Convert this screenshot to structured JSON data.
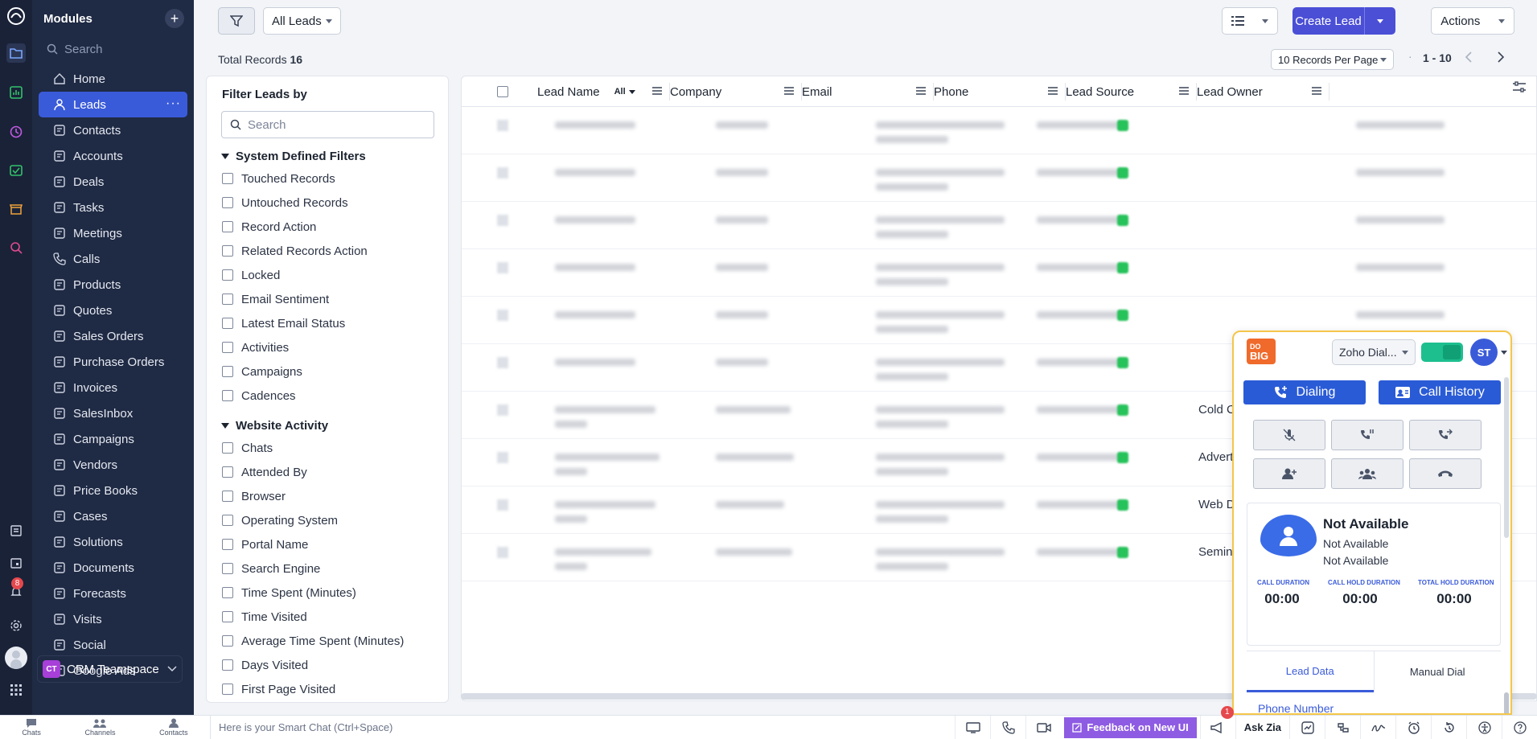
{
  "sidebar": {
    "title": "Modules",
    "search_placeholder": "Search",
    "items": [
      {
        "label": "Home",
        "icon": "home-icon"
      },
      {
        "label": "Leads",
        "icon": "leads-icon",
        "active": true
      },
      {
        "label": "Contacts",
        "icon": "contacts-icon"
      },
      {
        "label": "Accounts",
        "icon": "accounts-icon"
      },
      {
        "label": "Deals",
        "icon": "deals-icon"
      },
      {
        "label": "Tasks",
        "icon": "tasks-icon"
      },
      {
        "label": "Meetings",
        "icon": "meetings-icon"
      },
      {
        "label": "Calls",
        "icon": "calls-icon"
      },
      {
        "label": "Products",
        "icon": "products-icon"
      },
      {
        "label": "Quotes",
        "icon": "quotes-icon"
      },
      {
        "label": "Sales Orders",
        "icon": "sales-orders-icon"
      },
      {
        "label": "Purchase Orders",
        "icon": "purchase-orders-icon"
      },
      {
        "label": "Invoices",
        "icon": "invoices-icon"
      },
      {
        "label": "SalesInbox",
        "icon": "salesinbox-icon"
      },
      {
        "label": "Campaigns",
        "icon": "campaigns-icon"
      },
      {
        "label": "Vendors",
        "icon": "vendors-icon"
      },
      {
        "label": "Price Books",
        "icon": "price-books-icon"
      },
      {
        "label": "Cases",
        "icon": "cases-icon"
      },
      {
        "label": "Solutions",
        "icon": "solutions-icon"
      },
      {
        "label": "Documents",
        "icon": "documents-icon"
      },
      {
        "label": "Forecasts",
        "icon": "forecasts-icon"
      },
      {
        "label": "Visits",
        "icon": "visits-icon"
      },
      {
        "label": "Social",
        "icon": "social-icon"
      },
      {
        "label": "Google Ads",
        "icon": "google-ads-icon"
      }
    ],
    "teamspace": {
      "badge": "CT",
      "name": "CRM Teamspace"
    }
  },
  "rail": {
    "notification_count": "8"
  },
  "toolbar": {
    "view_select": "All Leads",
    "create_label": "Create Lead",
    "actions_label": "Actions"
  },
  "records": {
    "total_label": "Total Records",
    "total_count": "16",
    "per_page": "10 Records Per Page",
    "range": "1 - 10"
  },
  "filters": {
    "title": "Filter Leads by",
    "search_placeholder": "Search",
    "system_section": "System Defined Filters",
    "system_items": [
      "Touched Records",
      "Untouched Records",
      "Record Action",
      "Related Records Action",
      "Locked",
      "Email Sentiment",
      "Latest Email Status",
      "Activities",
      "Campaigns",
      "Cadences"
    ],
    "website_section": "Website Activity",
    "website_items": [
      "Chats",
      "Attended By",
      "Browser",
      "Operating System",
      "Portal Name",
      "Search Engine",
      "Time Spent (Minutes)",
      "Time Visited",
      "Average Time Spent (Minutes)",
      "Days Visited",
      "First Page Visited"
    ]
  },
  "table": {
    "columns": [
      "Lead Name",
      "Company",
      "Email",
      "Phone",
      "Lead Source",
      "Lead Owner"
    ],
    "name_filter": "All",
    "lead_sources": [
      "",
      "",
      "",
      "",
      "",
      "",
      "Cold C",
      "Advert",
      "Web D",
      "Semina"
    ]
  },
  "dialer": {
    "logo_top": "DO",
    "logo_bottom": "BIG",
    "provider": "Zoho Dial...",
    "user_initials": "ST",
    "dialing_label": "Dialing",
    "history_label": "Call History",
    "status_title": "Not Available",
    "status_line1": "Not Available",
    "status_line2": "Not Available",
    "call_duration_label": "Call Duration",
    "call_duration": "00:00",
    "hold_duration_label": "Call Hold Duration",
    "hold_duration": "00:00",
    "total_hold_label": "Total Hold Duration",
    "total_hold": "00:00",
    "tab_lead_data": "Lead Data",
    "tab_manual_dial": "Manual Dial",
    "phone_label": "Phone Number"
  },
  "bottombar": {
    "chats": "Chats",
    "channels": "Channels",
    "contacts": "Contacts",
    "chat_placeholder": "Here is your Smart Chat (Ctrl+Space)",
    "feedback": "Feedback on New UI",
    "ask_zia": "Ask Zia",
    "announce_count": "1"
  },
  "colors": {
    "accent": "#4b4fd6",
    "sidebar": "#1f2a44",
    "active": "#3a5bd9",
    "dialer_border": "#f4c64a"
  }
}
